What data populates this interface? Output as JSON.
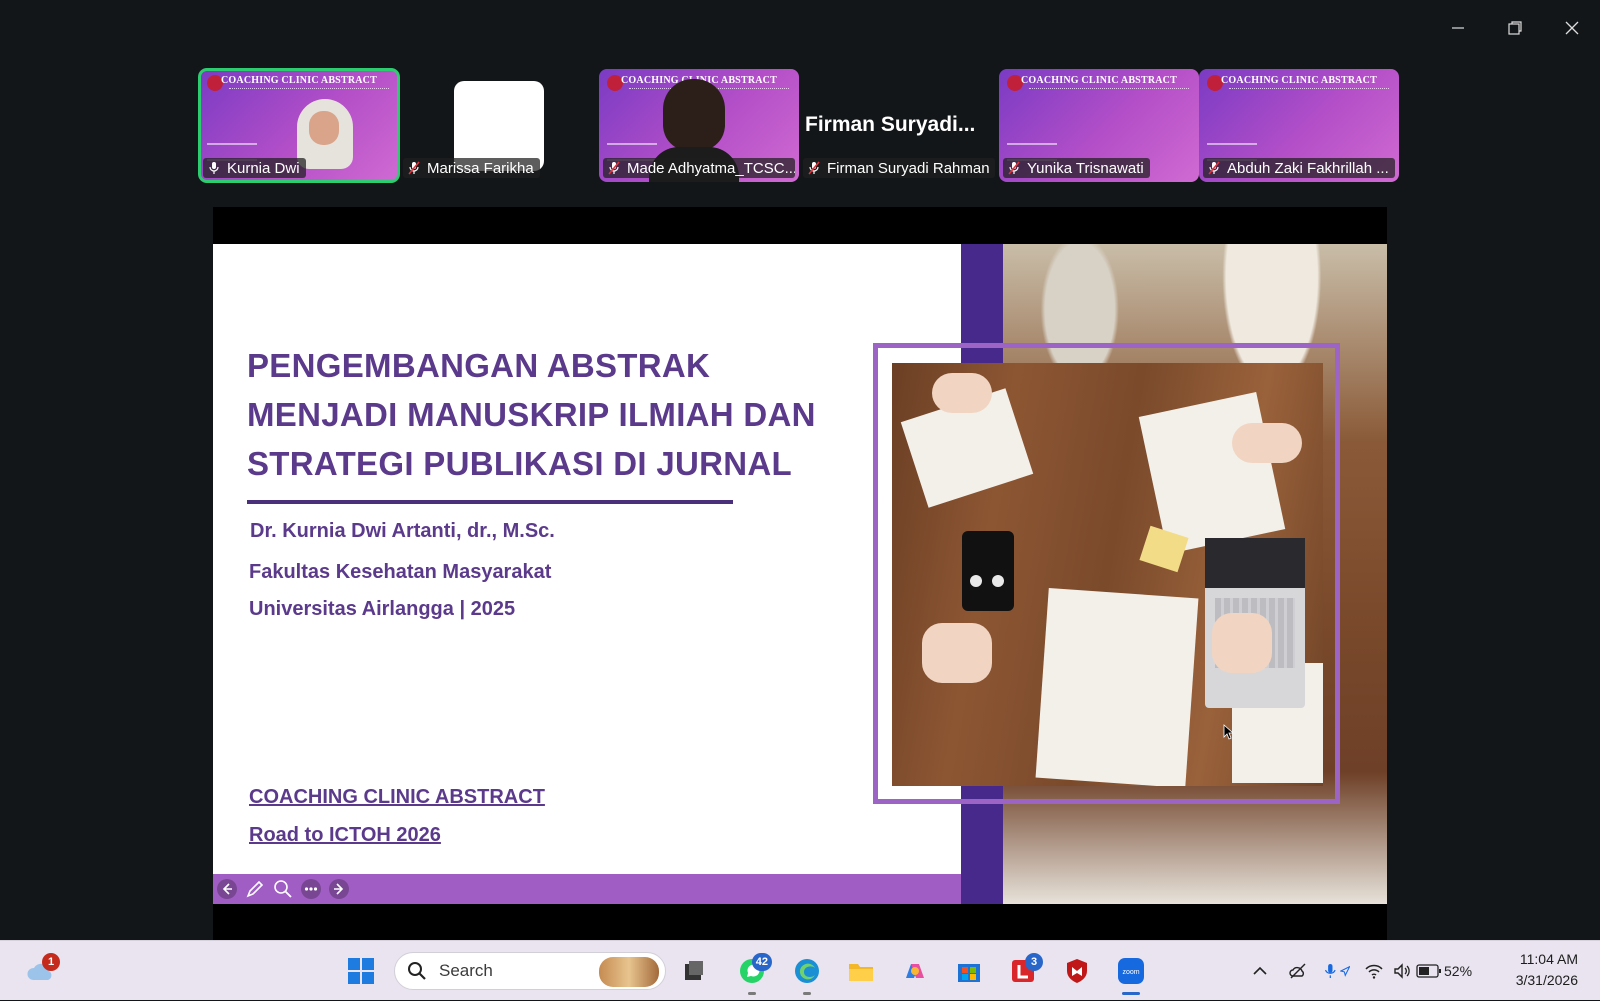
{
  "window": {
    "controls": [
      "minimize-icon",
      "restore-icon",
      "close-icon"
    ]
  },
  "participants": [
    {
      "name": "Kurnia Dwi",
      "type": "video",
      "active": true,
      "mic": "unmuted",
      "banner": "COACHING CLINIC ABSTRACT"
    },
    {
      "name": "Marissa Farikha",
      "type": "avatar-blank",
      "mic": "muted"
    },
    {
      "name": "Made Adhyatma_TCSC...",
      "type": "video",
      "mic": "muted",
      "banner": "COACHING CLINIC ABSTRACT"
    },
    {
      "name": "Firman Suryadi Rahman",
      "type": "name-only",
      "display": "Firman  Suryadi...",
      "mic": "muted"
    },
    {
      "name": "Yunika Trisnawati",
      "type": "video",
      "mic": "muted",
      "banner": "COACHING CLINIC ABSTRACT"
    },
    {
      "name": "Abduh Zaki Fakhrillah ...",
      "type": "video",
      "mic": "muted",
      "banner": "COACHING CLINIC ABSTRACT"
    }
  ],
  "slide": {
    "title": "PENGEMBANGAN ABSTRAK MENJADI MANUSKRIP ILMIAH DAN STRATEGI PUBLIKASI DI JURNAL",
    "author": "Dr. Kurnia Dwi Artanti, dr., M.Sc.",
    "faculty": "Fakultas Kesehatan Masyarakat",
    "university": "Universitas Airlangga | 2025",
    "link1": "COACHING CLINIC ABSTRACT",
    "link2": "Road to ICTOH 2026",
    "colors": {
      "title": "#5b3a8c",
      "panel": "#46298a",
      "frame": "#9b64c5",
      "bar": "#a05ec4"
    },
    "nav_tools": [
      "arrow-left-icon",
      "pen-icon",
      "zoom-icon",
      "more-icon",
      "arrow-right-icon"
    ]
  },
  "taskbar": {
    "weather_badge": "1",
    "search_placeholder": "Search",
    "apps": [
      {
        "name": "windows-start",
        "badge": ""
      },
      {
        "name": "task-view",
        "badge": ""
      },
      {
        "name": "whatsapp",
        "badge": "42"
      },
      {
        "name": "edge",
        "badge": ""
      },
      {
        "name": "file-explorer",
        "badge": ""
      },
      {
        "name": "copilot",
        "badge": ""
      },
      {
        "name": "microsoft-store",
        "badge": ""
      },
      {
        "name": "l-app",
        "badge": "3"
      },
      {
        "name": "mcafee",
        "badge": ""
      },
      {
        "name": "zoom",
        "badge": "",
        "label": "zoom"
      }
    ],
    "battery_percent": "52%",
    "time": "11:04 AM",
    "date": "3/31/2026"
  }
}
